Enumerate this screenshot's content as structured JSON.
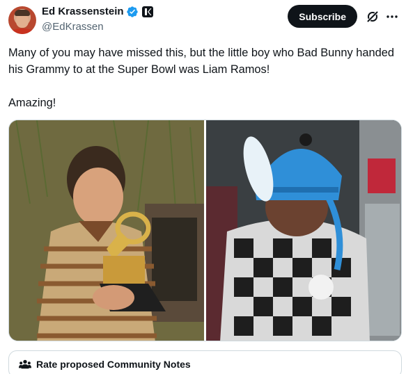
{
  "author": {
    "display_name": "Ed Krassenstein",
    "handle": "@EdKrassen",
    "verified": true
  },
  "actions": {
    "subscribe_label": "Subscribe"
  },
  "post": {
    "text": "Many of you may have missed this, but the little boy who Bad Bunny handed his Grammy to at the Super Bowl was Liam Ramos!\n\nAmazing!"
  },
  "media": {
    "photos": [
      {
        "description_icon": "boy-holding-grammy-photo"
      },
      {
        "description_icon": "child-in-blue-hat-photo"
      }
    ]
  },
  "community_notes": {
    "label": "Rate proposed Community Notes"
  },
  "colors": {
    "verified_blue": "#1d9bf0",
    "text_primary": "#0f1419",
    "text_secondary": "#536471",
    "border": "#cfd9de"
  }
}
